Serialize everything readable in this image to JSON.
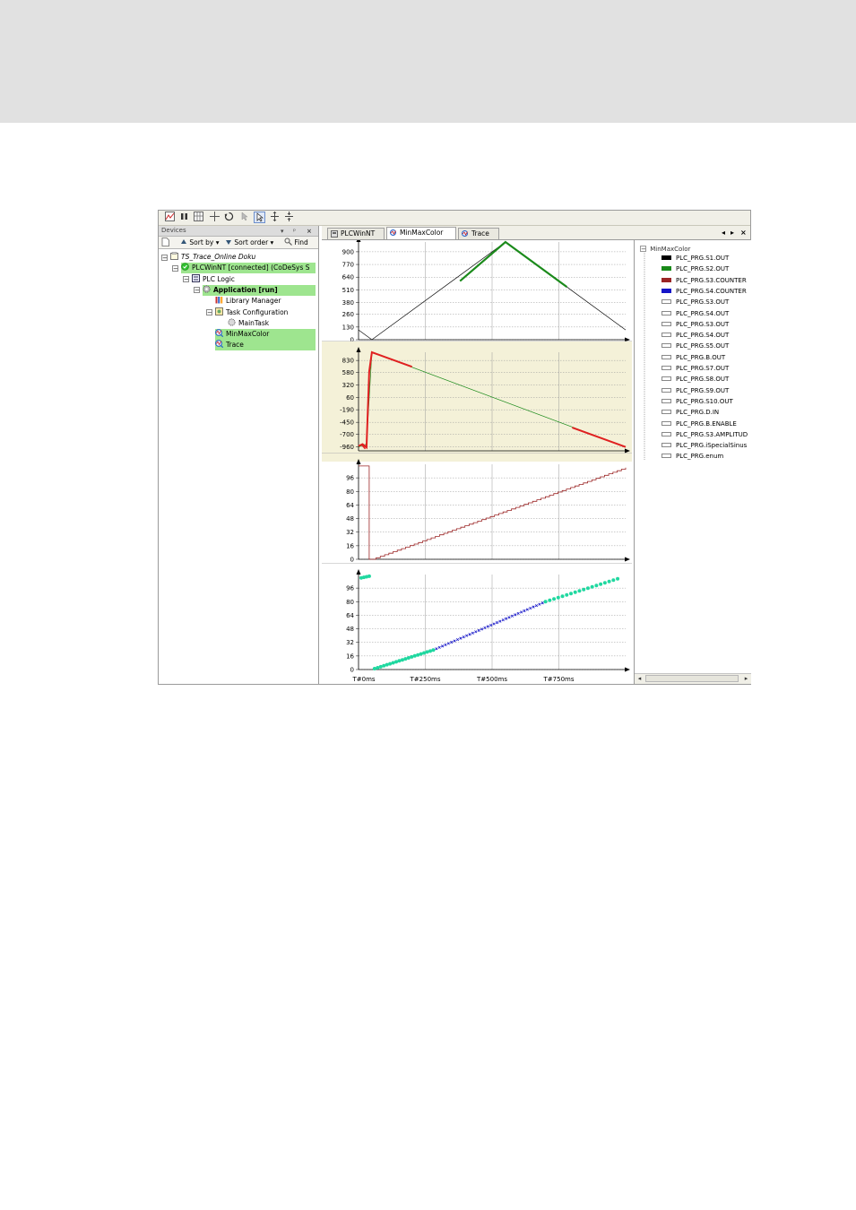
{
  "colors": {
    "green": "#1a8a1a",
    "red": "#e02020",
    "darkred": "#9b2525",
    "blue": "#1515c8",
    "cyan": "#20d8a0",
    "highlight": "#9ee58f",
    "plot2_bg": "#f4f1d8"
  },
  "toolbar": {
    "icons": [
      "chart-config-icon",
      "pause-icon",
      "grid-icon",
      "cross-icon",
      "reset-icon",
      "cursor-icon",
      "select-pointer-icon",
      "zoom-in-icon",
      "zoom-out-icon"
    ]
  },
  "devices": {
    "title": "Devices",
    "controls": [
      "▾",
      "ᵖ",
      "×"
    ],
    "sort_by": "Sort by",
    "sort_order": "Sort order",
    "find": "Find",
    "tree": [
      {
        "label": "TS_Trace_Online Doku",
        "level": 0,
        "expander": "−",
        "icon": "project-icon",
        "highlight": false,
        "italic": true
      },
      {
        "label": "PLCWinNT [connected] (CoDeSys S",
        "level": 1,
        "expander": "−",
        "icon": "device-connected-icon",
        "highlight": true,
        "italic": false
      },
      {
        "label": "PLC Logic",
        "level": 2,
        "expander": "−",
        "icon": "plc-logic-icon",
        "highlight": false,
        "italic": false
      },
      {
        "label": "Application [run]",
        "level": 3,
        "expander": "−",
        "icon": "application-gear-icon",
        "highlight": true,
        "bold": true
      },
      {
        "label": "Library Manager",
        "level": 4,
        "expander": "",
        "icon": "library-icon",
        "highlight": false
      },
      {
        "label": "Task Configuration",
        "level": 4,
        "expander": "−",
        "icon": "task-config-icon",
        "highlight": false
      },
      {
        "label": "MainTask",
        "level": 5,
        "expander": "",
        "icon": "main-task-icon",
        "highlight": false
      },
      {
        "label": "MinMaxColor",
        "level": 4,
        "expander": "",
        "icon": "trace-icon",
        "highlight": true
      },
      {
        "label": "Trace",
        "level": 4,
        "expander": "",
        "icon": "trace-icon",
        "highlight": true
      }
    ]
  },
  "tabs": [
    {
      "label": "PLCWinNT",
      "active": false
    },
    {
      "label": "MinMaxColor",
      "active": true
    },
    {
      "label": "Trace",
      "active": false
    }
  ],
  "tab_nav": {
    "left": "◂",
    "right": "▸",
    "close": "×"
  },
  "legend": {
    "root": "MinMaxColor",
    "items": [
      {
        "label": "PLC_PRG.S1.OUT",
        "color": "#000000"
      },
      {
        "label": "PLC_PRG.S2.OUT",
        "color": "#1a8a1a"
      },
      {
        "label": "PLC_PRG.S3.COUNTER",
        "color": "#9b2525"
      },
      {
        "label": "PLC_PRG.S4.COUNTER",
        "color": "#1515c8"
      },
      {
        "label": "PLC_PRG.S3.OUT",
        "color": ""
      },
      {
        "label": "PLC_PRG.S4.OUT",
        "color": ""
      },
      {
        "label": "PLC_PRG.S3.OUT",
        "color": ""
      },
      {
        "label": "PLC_PRG.S4.OUT",
        "color": ""
      },
      {
        "label": "PLC_PRG.S5.OUT",
        "color": ""
      },
      {
        "label": "PLC_PRG.B.OUT",
        "color": ""
      },
      {
        "label": "PLC_PRG.S7.OUT",
        "color": ""
      },
      {
        "label": "PLC_PRG.S8.OUT",
        "color": ""
      },
      {
        "label": "PLC_PRG.S9.OUT",
        "color": ""
      },
      {
        "label": "PLC_PRG.S10.OUT",
        "color": ""
      },
      {
        "label": "PLC_PRG.D.IN",
        "color": ""
      },
      {
        "label": "PLC_PRG.B.ENABLE",
        "color": ""
      },
      {
        "label": "PLC_PRG.S3.AMPLITUD",
        "color": ""
      },
      {
        "label": "PLC_PRG.iSpecialSinus",
        "color": ""
      },
      {
        "label": "PLC_PRG.enum",
        "color": ""
      }
    ]
  },
  "chart_data": [
    {
      "type": "line",
      "ylim": [
        0,
        1000
      ],
      "yticks": [
        "0",
        "130",
        "260",
        "380",
        "510",
        "640",
        "770",
        "900"
      ],
      "yvals": [
        0,
        130,
        260,
        380,
        510,
        640,
        770,
        900
      ],
      "xlim": [
        0,
        1000
      ],
      "series": [
        {
          "name": "PLC_PRG.S1.OUT",
          "color": "#000000",
          "width": 0.7,
          "x": [
            0,
            50,
            550,
            1000
          ],
          "y": [
            100,
            0,
            1000,
            100
          ]
        },
        {
          "name": "PLC_PRG.S2.OUT",
          "color": "#1a8a1a",
          "width": 2.2,
          "x": [
            380,
            550,
            780
          ],
          "y": [
            600,
            1000,
            540
          ]
        }
      ]
    },
    {
      "type": "line",
      "ylim": [
        -1040,
        1000
      ],
      "yticks": [
        "-960",
        "-700",
        "-450",
        "-190",
        "60",
        "320",
        "580",
        "830"
      ],
      "yvals": [
        -960,
        -700,
        -450,
        -190,
        60,
        320,
        580,
        830
      ],
      "xlim": [
        0,
        1000
      ],
      "background": "#f4f1d8",
      "series": [
        {
          "name": "PLC_PRG.S3.COUNTER",
          "color": "#1a8a1a",
          "width": 0.7,
          "x": [
            0,
            30,
            50,
            1000
          ],
          "y": [
            -960,
            -900,
            1000,
            -960
          ]
        },
        {
          "name": "PLC_PRG.S3.COUNTER",
          "color": "#e02020",
          "width": 2.0,
          "x": [
            0,
            15,
            30,
            40,
            50,
            70,
            200
          ],
          "y": [
            -940,
            -900,
            -970,
            600,
            1000,
            960,
            700
          ]
        },
        {
          "name": "PLC_PRG.S3.COUNTER",
          "color": "#e02020",
          "width": 2.0,
          "x": [
            800,
            1000
          ],
          "y": [
            -560,
            -960
          ]
        },
        {
          "name": "PLC_PRG.S3.COUNTER",
          "color": "#e02020",
          "width": 1.5,
          "x": [
            10,
            25
          ],
          "y": [
            -900,
            -1000
          ]
        }
      ]
    },
    {
      "type": "line",
      "ylim": [
        0,
        112
      ],
      "yticks": [
        "0",
        "16",
        "32",
        "48",
        "64",
        "80",
        "96"
      ],
      "yvals": [
        0,
        16,
        32,
        48,
        64,
        80,
        96
      ],
      "xlim": [
        0,
        1000
      ],
      "series": [
        {
          "name": "PLC_PRG.S3.COUNTER",
          "color": "#9b2525",
          "width": 0.8,
          "step": true,
          "x0": 50,
          "x1": 1000,
          "y0": 0,
          "y1": 108,
          "steps": 60,
          "pre": {
            "x": [
              0,
              40,
              40,
              50
            ],
            "y": [
              110,
              110,
              0,
              0
            ]
          }
        }
      ]
    },
    {
      "type": "scatter",
      "ylim": [
        0,
        112
      ],
      "yticks": [
        "0",
        "16",
        "32",
        "48",
        "64",
        "80",
        "96"
      ],
      "yvals": [
        0,
        16,
        32,
        48,
        64,
        80,
        96
      ],
      "xlim": [
        0,
        1000
      ],
      "xticks": [
        "T#0ms",
        "T#250ms",
        "T#500ms",
        "T#750ms"
      ],
      "xvals": [
        0,
        250,
        500,
        750
      ],
      "series": [
        {
          "name": "PLC_PRG.S4.COUNTER",
          "color": "#1515c8",
          "marker": "x",
          "x0": 280,
          "x1": 700,
          "y0": 23,
          "y1": 80,
          "n": 38
        },
        {
          "name": "PLC_PRG.S4.COUNTER",
          "color": "#20d8a0",
          "marker": "dot",
          "x0": 60,
          "x1": 280,
          "y0": 1,
          "y1": 23,
          "n": 20
        },
        {
          "name": "PLC_PRG.S4.COUNTER",
          "color": "#20d8a0",
          "marker": "dot",
          "x0": 700,
          "x1": 970,
          "y0": 80,
          "y1": 107,
          "n": 18
        },
        {
          "name": "PLC_PRG.S4.COUNTER",
          "color": "#20d8a0",
          "marker": "dot",
          "x0": 10,
          "x1": 40,
          "y0": 108,
          "y1": 110,
          "n": 4
        }
      ]
    }
  ]
}
